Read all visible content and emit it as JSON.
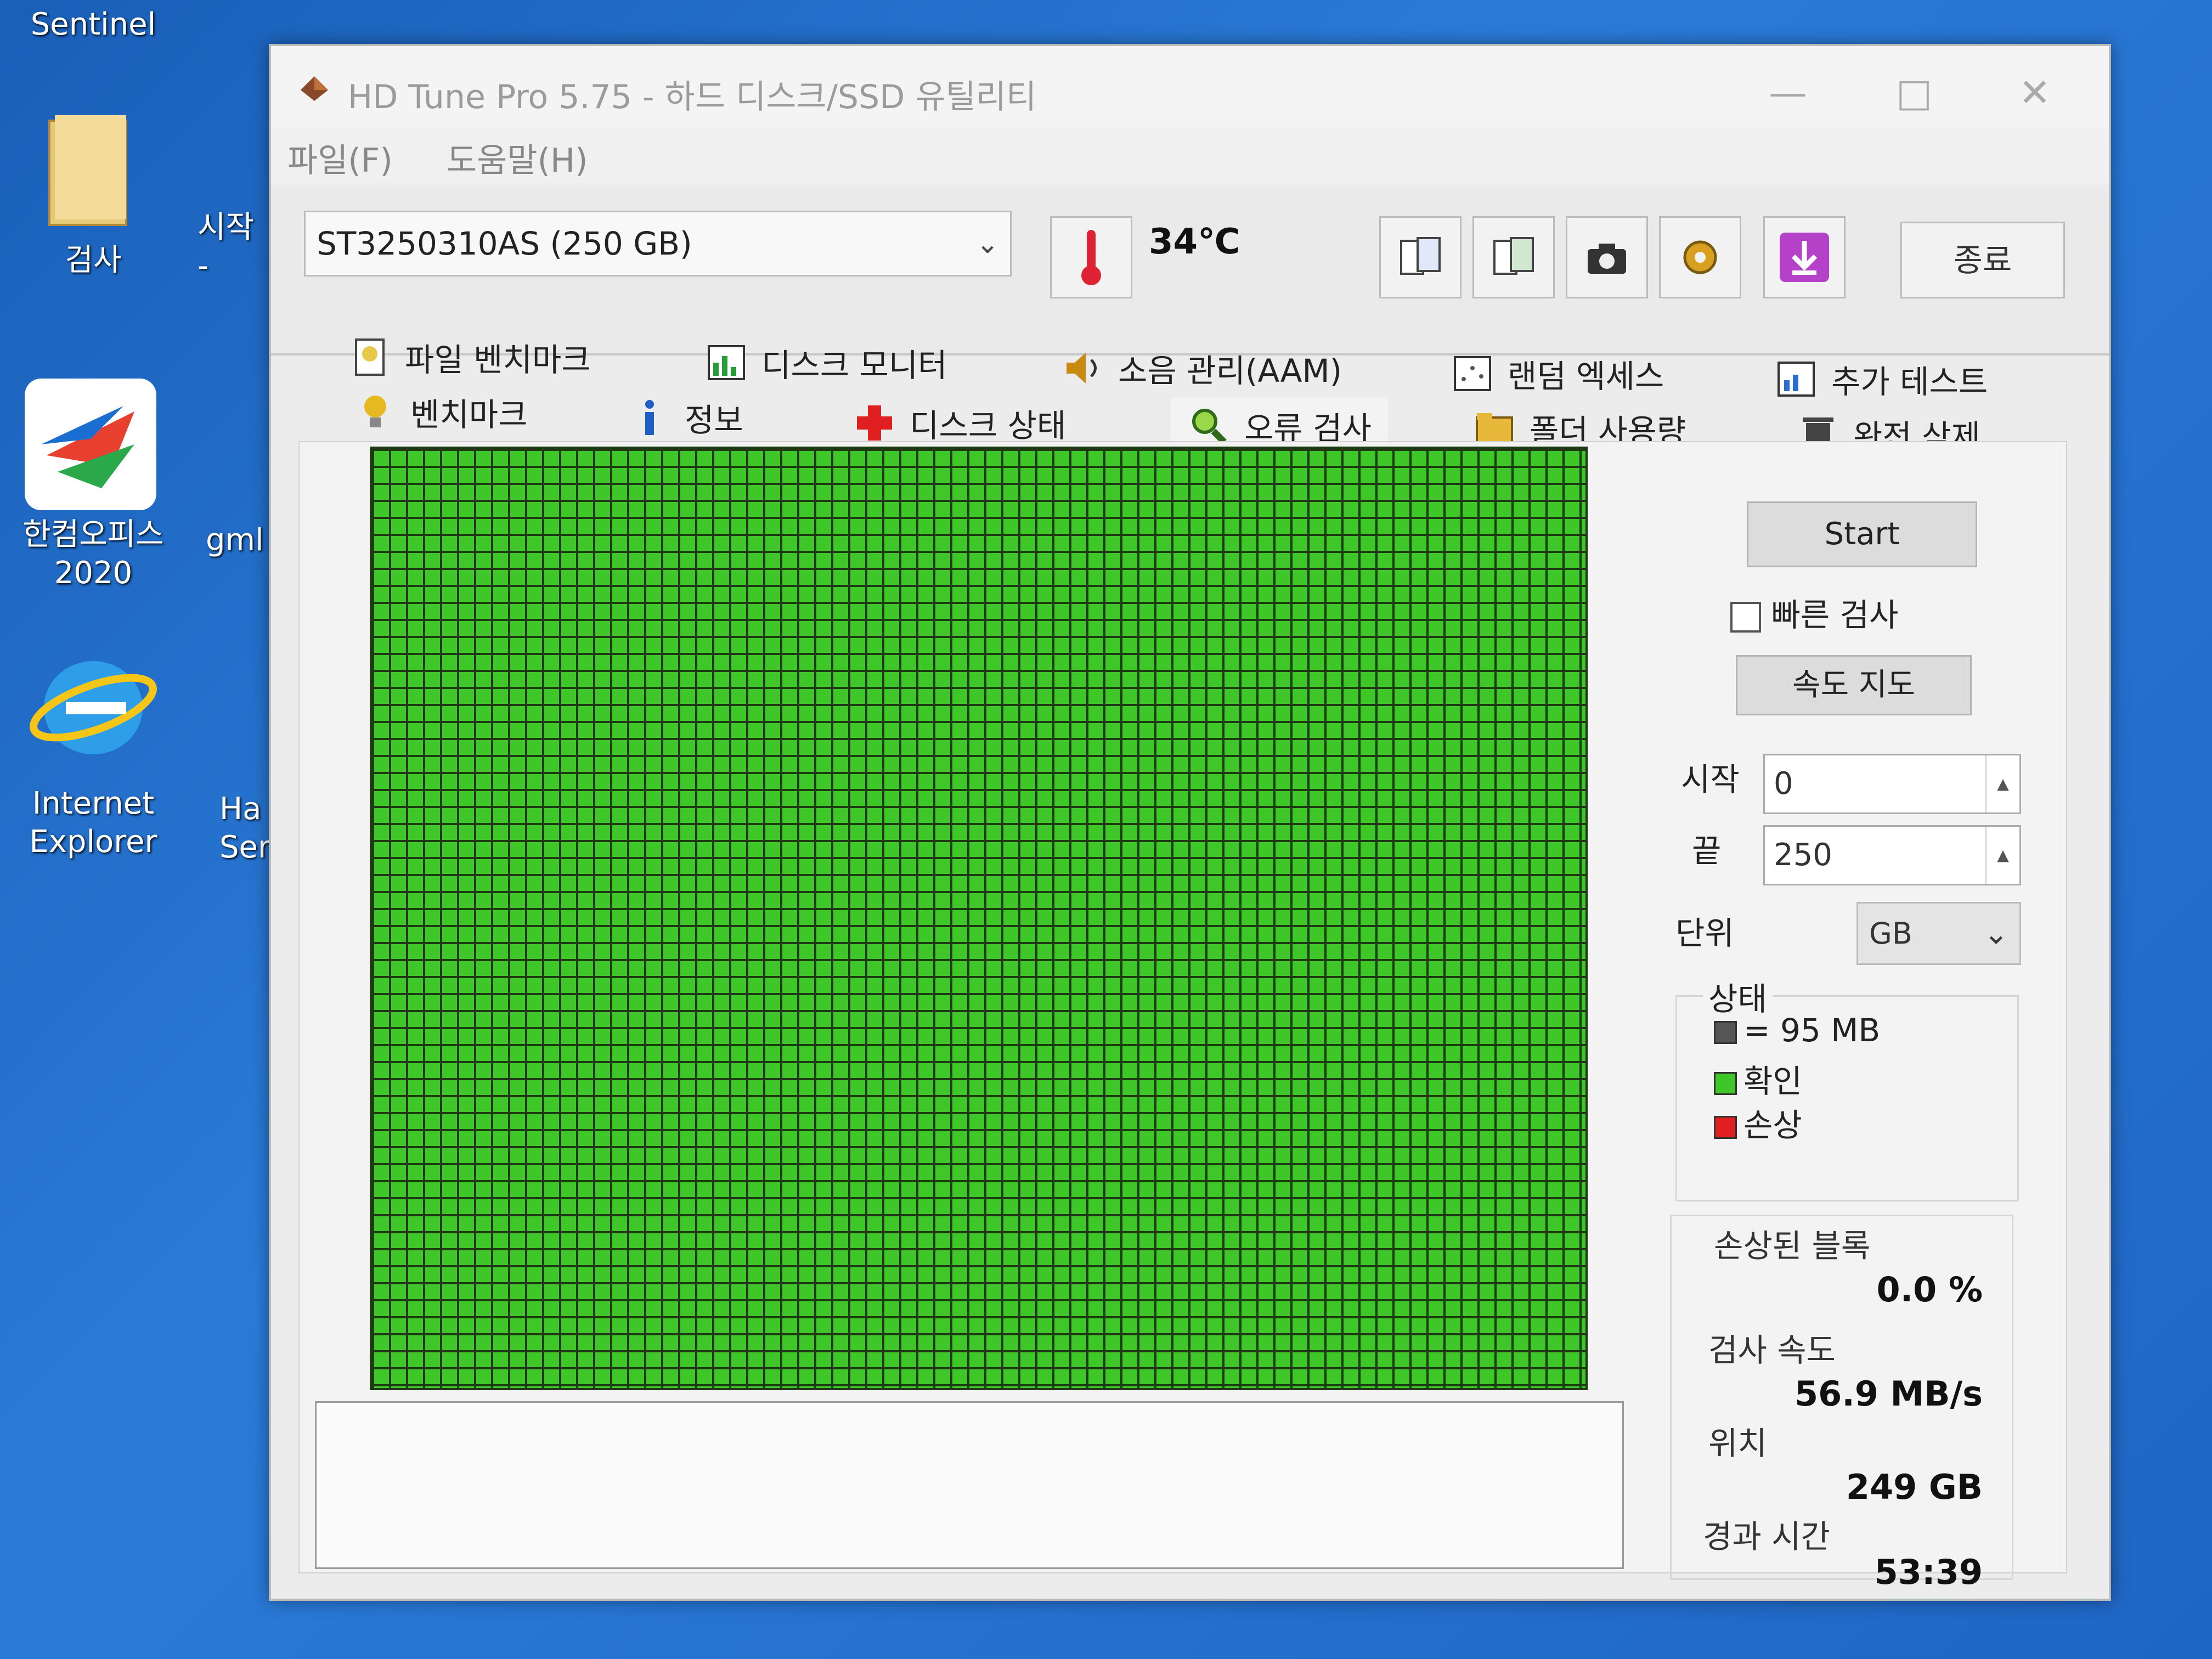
{
  "desktop": {
    "icons": [
      {
        "label": "Sentinel"
      },
      {
        "label": "검사"
      },
      {
        "label": "한컴오피스\n2020"
      },
      {
        "label": "Internet\nExplorer"
      },
      {
        "label": "시작\n-"
      },
      {
        "label": "gml"
      },
      {
        "label": "Ha\nSer"
      }
    ]
  },
  "window": {
    "title": "HD Tune Pro 5.75 - 하드 디스크/SSD 유틸리티",
    "menu": {
      "file": "파일(F)",
      "help": "도움말(H)"
    },
    "toolbar": {
      "drive": "ST3250310AS (250 GB)",
      "temperature": "34℃",
      "exit_label": "종료",
      "icons": [
        "copy-info-icon",
        "copy-all-icon",
        "screenshot-icon",
        "options-icon",
        "save-download-icon"
      ]
    },
    "tabs_row1": [
      {
        "label": "파일 벤치마크",
        "icon": "file-benchmark-icon"
      },
      {
        "label": "디스크 모니터",
        "icon": "disk-monitor-icon"
      },
      {
        "label": "소음 관리(AAM)",
        "icon": "speaker-icon"
      },
      {
        "label": "랜덤 엑세스",
        "icon": "random-access-icon"
      },
      {
        "label": "추가 테스트",
        "icon": "extra-tests-icon"
      }
    ],
    "tabs_row2": [
      {
        "label": "벤치마크",
        "icon": "benchmark-bulb-icon"
      },
      {
        "label": "정보",
        "icon": "info-icon"
      },
      {
        "label": "디스크 상태",
        "icon": "health-cross-icon"
      },
      {
        "label": "오류 검사",
        "icon": "magnifier-icon"
      },
      {
        "label": "폴더 사용량",
        "icon": "folder-icon"
      },
      {
        "label": "완전 삭제",
        "icon": "trash-icon"
      }
    ],
    "active_tab": "오류 검사",
    "error_scan": {
      "start_label": "Start",
      "quick_scan_label": "빠른 검사",
      "quick_scan_checked": false,
      "speed_map_label": "속도 지도",
      "start_field_label": "시작",
      "start_value": "0",
      "end_field_label": "끝",
      "end_value": "250",
      "unit_label": "단위",
      "unit_value": "GB",
      "legend_title": "상태",
      "legend_block": "= 95 MB",
      "legend_ok": "확인",
      "legend_damaged": "손상",
      "damaged_blocks_label": "손상된 블록",
      "damaged_blocks_value": "0.0 %",
      "scan_speed_label": "검사 속도",
      "scan_speed_value": "56.9 MB/s",
      "position_label": "위치",
      "position_value": "249 GB",
      "elapsed_label": "경과 시간",
      "elapsed_value": "53:39",
      "block_status": "all-ok",
      "colors": {
        "ok": "#3fc72a",
        "damaged": "#e02020",
        "block": "#555555",
        "grid_line": "#1e3a12"
      }
    }
  }
}
